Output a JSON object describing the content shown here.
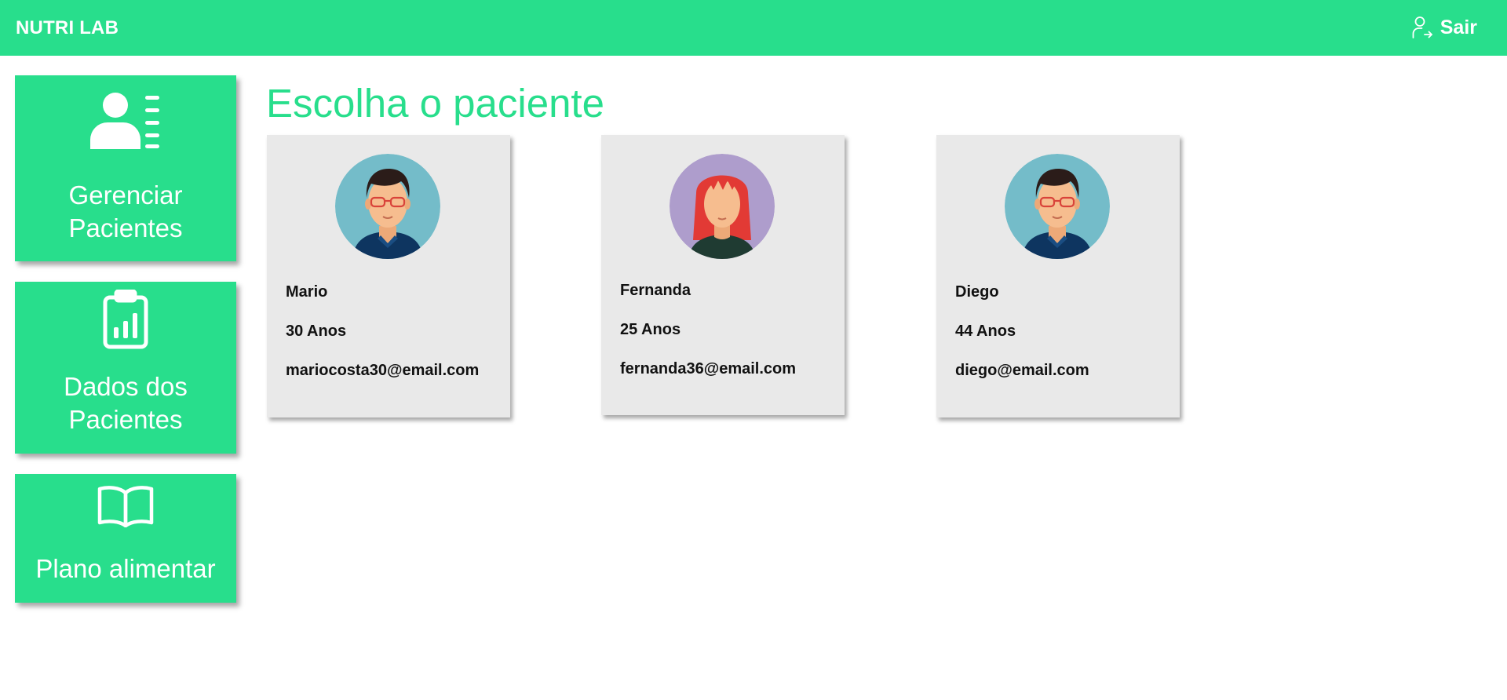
{
  "header": {
    "brand": "NUTRI LAB",
    "logout_label": "Sair",
    "background_color": "#28de8c",
    "logout_icon": "user-logout-icon"
  },
  "sidebar": {
    "items": [
      {
        "label": "Gerenciar Pacientes",
        "icon": "user-list-icon"
      },
      {
        "label": "Dados dos Pacientes",
        "icon": "clipboard-chart-icon"
      },
      {
        "label": "Plano alimentar",
        "icon": "open-book-icon"
      }
    ],
    "accent_color": "#28de8c"
  },
  "main": {
    "title": "Escolha o paciente",
    "title_color": "#28de8c",
    "patients": [
      {
        "name": "Mario",
        "age": "30 Anos",
        "email": "mariocosta30@email.com",
        "avatar": "male-avatar-icon",
        "avatar_bg": "#74bcc9"
      },
      {
        "name": "Fernanda",
        "age": "25 Anos",
        "email": "fernanda36@email.com",
        "avatar": "female-avatar-icon",
        "avatar_bg": "#ae9dcc"
      },
      {
        "name": "Diego",
        "age": "44 Anos",
        "email": "diego@email.com",
        "avatar": "male-avatar-icon",
        "avatar_bg": "#74bcc9"
      }
    ],
    "card_color": "#e9e9e9"
  }
}
